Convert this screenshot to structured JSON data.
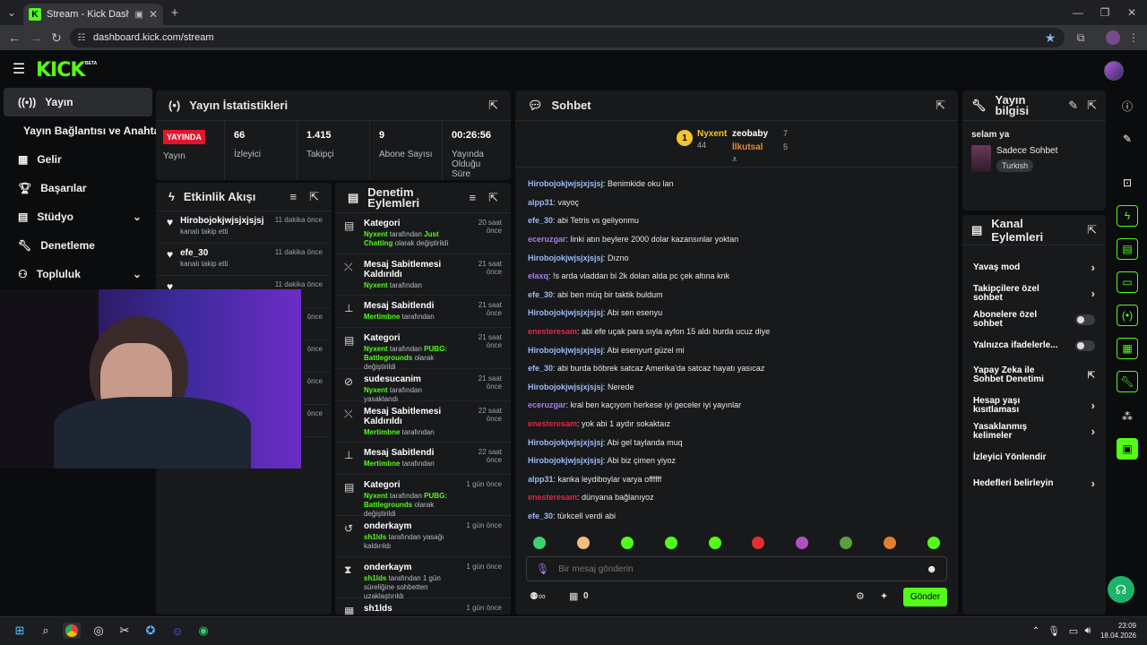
{
  "browser": {
    "tab_title": "Stream - Kick Dashboard",
    "url": "dashboard.kick.com/stream"
  },
  "header": {
    "logo": "KICK",
    "logo_badge": "BETA"
  },
  "sidebar": {
    "items": [
      {
        "label": "Yayın",
        "icon": "broadcast-icon"
      },
      {
        "label": "Yayın Bağlantısı ve Anahtarı"
      },
      {
        "label": "Gelir",
        "icon": "revenue-icon"
      },
      {
        "label": "Başarılar",
        "icon": "trophy-icon"
      },
      {
        "label": "Stüdyo",
        "icon": "studio-icon"
      },
      {
        "label": "Denetleme",
        "icon": "wrench-icon"
      },
      {
        "label": "Topluluk",
        "icon": "community-icon"
      }
    ]
  },
  "stats": {
    "title": "Yayın İstatistikleri",
    "status": "YAYINDA",
    "status_label": "Yayın",
    "viewers": "66",
    "viewers_label": "İzleyici",
    "followers": "1.415",
    "followers_label": "Takipçi",
    "subs": "9",
    "subs_label": "Abone Sayısı",
    "uptime": "00:26:56",
    "uptime_label": "Yayında Olduğu Süre"
  },
  "activity": {
    "title": "Etkinlik Akışı",
    "items": [
      {
        "user": "Hirobojokjwjsjxjsjsj",
        "text": "kanalı takip etti",
        "time": "11 dakika önce"
      },
      {
        "user": "efe_30",
        "text": "kanalı takip etti",
        "time": "11 dakika önce"
      },
      {
        "user": "",
        "text": "",
        "time": "11 dakika önce"
      },
      {
        "user": "",
        "text": "",
        "time": "önce"
      },
      {
        "user": "",
        "text": "",
        "time": "önce"
      },
      {
        "user": "",
        "text": "",
        "time": "önce"
      },
      {
        "user": "",
        "text": "",
        "time": "önce"
      }
    ]
  },
  "moderation": {
    "title": "Denetim Eylemleri",
    "items": [
      {
        "icon": "category-icon",
        "title": "Kategori",
        "time": "20 saat önce",
        "actor": "Nyxent",
        "mid": " tarafından ",
        "target": "Just Chatting",
        "tail": " olarak değiştirildi"
      },
      {
        "icon": "unpin-icon",
        "title": "Mesaj Sabitlemesi Kaldırıldı",
        "time": "21 saat önce",
        "actor": "Nyxent",
        "mid": " tarafından",
        "target": "",
        "tail": ""
      },
      {
        "icon": "pin-icon",
        "title": "Mesaj Sabitlendi",
        "time": "21 saat önce",
        "actor": "Mertimbne",
        "mid": " tarafından",
        "target": "",
        "tail": ""
      },
      {
        "icon": "category-icon",
        "title": "Kategori",
        "time": "21 saat önce",
        "actor": "Nyxent",
        "mid": " tarafından ",
        "target": "PUBG: Battlegrounds",
        "tail": " olarak değiştirildi"
      },
      {
        "icon": "ban-icon",
        "title": "sudesucanim",
        "time": "21 saat önce",
        "actor": "Nyxent",
        "mid": " tarafından yasaklandı",
        "target": "",
        "tail": ""
      },
      {
        "icon": "unpin-icon",
        "title": "Mesaj Sabitlemesi Kaldırıldı",
        "time": "22 saat önce",
        "actor": "Mertimbne",
        "mid": " tarafından",
        "target": "",
        "tail": ""
      },
      {
        "icon": "pin-icon",
        "title": "Mesaj Sabitlendi",
        "time": "22 saat önce",
        "actor": "Mertimbne",
        "mid": " tarafından",
        "target": "",
        "tail": ""
      },
      {
        "icon": "category-icon",
        "title": "Kategori",
        "time": "1 gün önce",
        "actor": "Nyxent",
        "mid": " tarafından ",
        "target": "PUBG: Battlegrounds",
        "tail": " olarak değiştirildi"
      },
      {
        "icon": "unban-icon",
        "title": "onderkaym",
        "time": "1 gün önce",
        "actor": "sh1lds",
        "mid": " tarafından yasağı kaldırıldı",
        "target": "",
        "tail": ""
      },
      {
        "icon": "timeout-icon",
        "title": "onderkaym",
        "time": "1 gün önce",
        "actor": "sh1lds",
        "mid": " tarafından 1 gün süreliğine sohbetten uzaklaştırıldı",
        "target": "",
        "tail": ""
      },
      {
        "icon": "shop-icon",
        "title": "sh1lds",
        "time": "1 gün önce",
        "actor": "",
        "mid": "",
        "target": "",
        "tail": ""
      }
    ]
  },
  "chat": {
    "title": "Sohbet",
    "leaderboard": {
      "first": {
        "rank": "1",
        "name": "Nyxent",
        "count": "44"
      },
      "second": {
        "name": "zeobaby",
        "count": "7"
      },
      "third": {
        "name": "İlkutsal",
        "count": "5"
      }
    },
    "messages": [
      {
        "user": "Hirobojokjwjsjxjsjsj",
        "color": "#9ab9f5",
        "text": ": Benimkide oku lan"
      },
      {
        "user": "alpp31",
        "color": "#9ab9f5",
        "text": ": vayoç"
      },
      {
        "user": "efe_30",
        "color": "#9ab9f5",
        "text": ": abi Tetris vs geliyonmu"
      },
      {
        "user": "eceruzgar",
        "color": "#a97cf0",
        "text": ": linki atın beylere 2000 dolar kazansınlar yoktan"
      },
      {
        "user": "Hirobojokjwjsjxjsjsj",
        "color": "#9ab9f5",
        "text": ": Dızno"
      },
      {
        "user": "elaxq",
        "color": "#a97cf0",
        "text": ": !s arda vladdan bi 2k doları alda pc çek altına knk"
      },
      {
        "user": "efe_30",
        "color": "#9ab9f5",
        "text": ": abi ben müq bir taktik buldum"
      },
      {
        "user": "Hirobojokjwjsjxjsjsj",
        "color": "#9ab9f5",
        "text": ": Abi sen esenyu"
      },
      {
        "user": "enesteresam",
        "color": "#e0264c",
        "text": ": abi efe uçak para sıyla ayfon 15 aldı burda ucuz diye"
      },
      {
        "user": "Hirobojokjwjsjxjsjsj",
        "color": "#9ab9f5",
        "text": ": Abi esenyurt güzel mi"
      },
      {
        "user": "efe_30",
        "color": "#9ab9f5",
        "text": ": abi burda böbrek satcaz Amerika'da satcaz hayatı yasıcaz"
      },
      {
        "user": "Hirobojokjwjsjxjsjsj",
        "color": "#9ab9f5",
        "text": ": Nerede"
      },
      {
        "user": "eceruzgar",
        "color": "#a97cf0",
        "text": ": kral ben kaçıyom herkese iyi geceler iyi yayınlar"
      },
      {
        "user": "enesteresam",
        "color": "#e0264c",
        "text": ": yok abi 1 aydır sokaktaız"
      },
      {
        "user": "Hirobojokjwjsjxjsjsj",
        "color": "#9ab9f5",
        "text": ": Abi gel taylanda muq"
      },
      {
        "user": "Hirobojokjwjsjxjsjsj",
        "color": "#9ab9f5",
        "text": ": Abi biz çimen yiyoz"
      },
      {
        "user": "alpp31",
        "color": "#9ab9f5",
        "text": ": kanka leydiboylar varya offffff"
      },
      {
        "user": "enesteresam",
        "color": "#e0264c",
        "text": ": dünyana bağlanıyoz"
      },
      {
        "user": "efe_30",
        "color": "#9ab9f5",
        "text": ": türkcell verdi abi"
      }
    ],
    "placeholder": "Bir mesaj gönderin",
    "points": "0",
    "send_label": "Gönder"
  },
  "stream_info": {
    "title": "Yayın bilgisi",
    "stream_title": "selam ya",
    "category": "Sadece Sohbet",
    "tag": "Turkish"
  },
  "channel_actions": {
    "title": "Kanal Eylemleri",
    "items": [
      {
        "label": "Yavaş mod",
        "type": "arrow"
      },
      {
        "label": "Takipçilere özel sohbet",
        "type": "arrow"
      },
      {
        "label": "Abonelere özel sohbet",
        "type": "toggle"
      },
      {
        "label": "Yalnızca ifadelerle...",
        "type": "toggle"
      },
      {
        "label": "Yapay Zeka ile Sohbet Denetimi",
        "type": "external"
      },
      {
        "label": "Hesap yaşı kısıtlaması",
        "type": "arrow"
      },
      {
        "label": "Yasaklanmış kelimeler",
        "type": "arrow"
      },
      {
        "label": "İzleyici Yönlendir",
        "type": "none"
      },
      {
        "label": "Hedefleri belirleyin",
        "type": "arrow"
      }
    ]
  },
  "taskbar": {
    "time": "23:09",
    "date": "18.04.2026"
  },
  "colors": {
    "accent": "#53fc18",
    "live": "#e3152b",
    "panel": "#18191b",
    "background": "#0b0c0d"
  }
}
